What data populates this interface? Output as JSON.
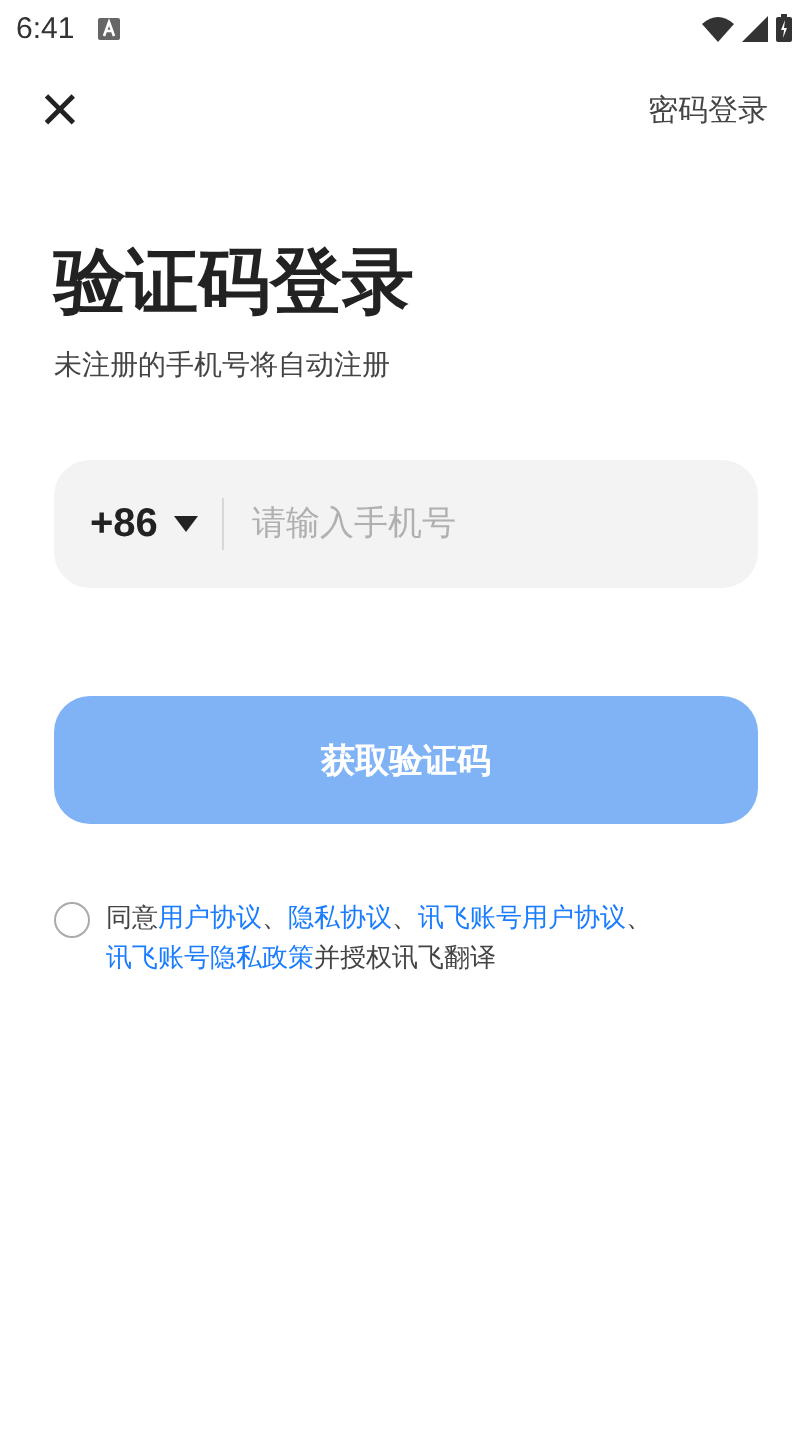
{
  "status_bar": {
    "time": "6:41"
  },
  "top_bar": {
    "close_label": "×",
    "password_login": "密码登录"
  },
  "title": "验证码登录",
  "subtitle": "未注册的手机号将自动注册",
  "phone": {
    "country_code": "+86",
    "placeholder": "请输入手机号"
  },
  "get_code_button": {
    "label": "获取验证码",
    "disabled": true
  },
  "agreement": {
    "checked": false,
    "parts": [
      {
        "kind": "text",
        "text": "同意"
      },
      {
        "kind": "link",
        "text": "用户协议"
      },
      {
        "kind": "text",
        "text": "、"
      },
      {
        "kind": "link",
        "text": "隐私协议"
      },
      {
        "kind": "text",
        "text": "、"
      },
      {
        "kind": "link",
        "text": "讯飞账号用户协议"
      },
      {
        "kind": "text",
        "text": "、"
      },
      {
        "kind": "link",
        "text": "讯飞账号隐私政策"
      },
      {
        "kind": "text",
        "text": "并授权讯飞翻译"
      }
    ]
  }
}
